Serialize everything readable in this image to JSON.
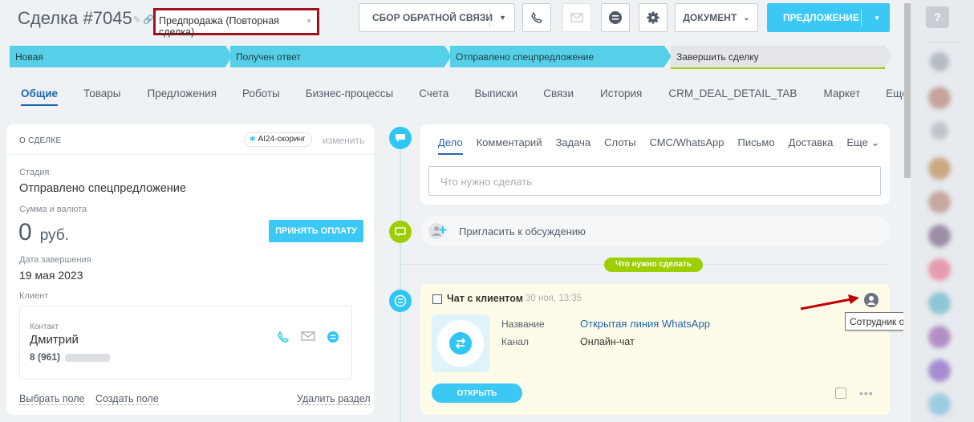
{
  "header": {
    "title": "Сделка #7045",
    "pipeline": "Предпродажа (Повторная сделка)",
    "feedback_label": "СБОР ОБРАТНОЙ СВЯЗИ",
    "document_label": "ДОКУМЕНТ",
    "offer_label": "ПРЕДЛОЖЕНИЕ"
  },
  "stages": [
    {
      "label": "Новая",
      "active": true
    },
    {
      "label": "Получен ответ",
      "active": true
    },
    {
      "label": "Отправлено спецпредложение",
      "active": true
    },
    {
      "label": "Завершить сделку",
      "active": false
    }
  ],
  "tabs": [
    "Общие",
    "Товары",
    "Предложения",
    "Роботы",
    "Бизнес-процессы",
    "Счета",
    "Выписки",
    "Связи",
    "История",
    "CRM_DEAL_DETAIL_TAB",
    "Маркет",
    "Еще"
  ],
  "deal": {
    "heading": "О СДЕЛКЕ",
    "ai_badge": "AI24-скоринг",
    "edit": "изменить",
    "stage_label": "Стадия",
    "stage_value": "Отправлено спецпредложение",
    "amount_label": "Сумма и валюта",
    "amount": "0",
    "currency": "руб.",
    "pay_button": "ПРИНЯТЬ ОПЛАТУ",
    "close_date_label": "Дата завершения",
    "close_date": "19 мая 2023",
    "client_label": "Клиент",
    "contact_label": "Контакт",
    "contact_name": "Дмитрий",
    "contact_phone": "8 (961)",
    "select_field": "Выбрать поле",
    "create_field": "Создать поле",
    "delete_section": "Удалить раздел"
  },
  "activity": {
    "tabs": [
      "Дело",
      "Комментарий",
      "Задача",
      "Слоты",
      "СМС/WhatsApp",
      "Письмо",
      "Доставка",
      "Еще"
    ],
    "input_placeholder": "Что нужно сделать",
    "invite": "Пригласить к обсуждению",
    "todo_badge": "Что нужно сделать"
  },
  "chat": {
    "title": "Чат с клиентом",
    "date": "30 ноя, 13:35",
    "name_label": "Название",
    "name_value": "Открытая линия WhatsApp",
    "channel_label": "Канал",
    "channel_value": "Онлайн-чат",
    "open_button": "ОТКРЫТЬ",
    "tooltip": "Сотрудник отдела продаж"
  },
  "right_panel": {
    "help": "?"
  },
  "colors": {
    "accent": "#3bc8f5",
    "link": "#2067b0",
    "green": "#9dcf00",
    "highlight": "#a3101b",
    "arrow": "#c00000"
  }
}
